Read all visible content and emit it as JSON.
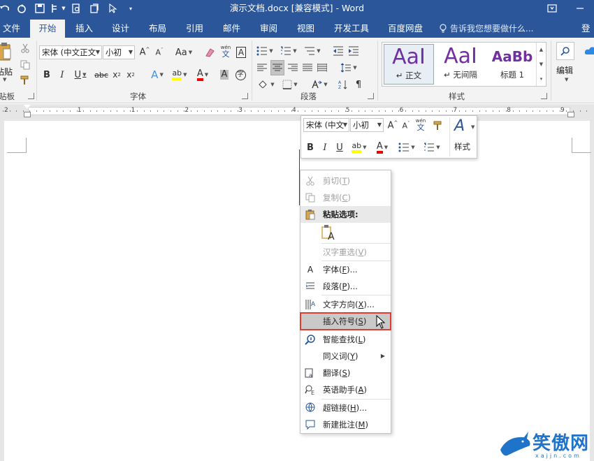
{
  "window": {
    "title": "演示文档.docx [兼容模式] - Word"
  },
  "ribbon_tabs": [
    {
      "label": "文件",
      "active": false
    },
    {
      "label": "开始",
      "active": true
    },
    {
      "label": "插入",
      "active": false
    },
    {
      "label": "设计",
      "active": false
    },
    {
      "label": "布局",
      "active": false
    },
    {
      "label": "引用",
      "active": false
    },
    {
      "label": "邮件",
      "active": false
    },
    {
      "label": "审阅",
      "active": false
    },
    {
      "label": "视图",
      "active": false
    },
    {
      "label": "开发工具",
      "active": false
    },
    {
      "label": "百度网盘",
      "active": false
    }
  ],
  "tell_me": "告诉我您想要做什么...",
  "login": "登录",
  "ribbon": {
    "clipboard": {
      "paste_label": "粘贴",
      "group_label": "贴板"
    },
    "font": {
      "font_name": "宋体 (中文正文",
      "font_size": "小初",
      "group_label": "字体",
      "change_case": "Aa",
      "phonetic": "wén"
    },
    "paragraph": {
      "group_label": "段落"
    },
    "styles": {
      "group_label": "样式",
      "items": [
        {
          "sample": "AaI",
          "name": "↵ 正文"
        },
        {
          "sample": "AaI",
          "name": "↵ 无间隔"
        },
        {
          "sample": "AaBb",
          "name": "标题 1"
        }
      ]
    },
    "editing": {
      "label": "编辑"
    }
  },
  "ruler": {
    "numbers": [
      "2",
      "1",
      "1",
      "2",
      "3",
      "4",
      "5",
      "6",
      "7",
      "8",
      "9",
      "10"
    ]
  },
  "mini_toolbar": {
    "font_name": "宋体 (中文",
    "font_size": "小初",
    "styles_label": "样式",
    "phonetic": "wén"
  },
  "context_menu": {
    "items": [
      {
        "label": "剪切(T)",
        "text": "剪切(",
        "key": "T",
        "close": ")",
        "icon": "scissors-icon",
        "disabled": true
      },
      {
        "label": "复制(C)",
        "text": "复制(",
        "key": "C",
        "close": ")",
        "icon": "copy-icon",
        "disabled": true
      },
      {
        "label": "粘贴选项:",
        "text": "粘贴选项:",
        "key": "",
        "close": "",
        "icon": "paste-icon",
        "header": true
      },
      {
        "label": "汉字重选(V)",
        "text": "汉字重选(",
        "key": "V",
        "close": ")",
        "icon": "",
        "disabled": true
      },
      {
        "label": "字体(F)...",
        "text": "字体(",
        "key": "F",
        "close": ")...",
        "icon": "font-icon"
      },
      {
        "label": "段落(P)...",
        "text": "段落(",
        "key": "P",
        "close": ")...",
        "icon": "paragraph-icon"
      },
      {
        "label": "文字方向(X)...",
        "text": "文字方向(",
        "key": "X",
        "close": ")...",
        "icon": "text-direction-icon"
      },
      {
        "label": "插入符号(S)",
        "text": "插入符号(",
        "key": "S",
        "close": ")",
        "icon": "",
        "highlight": true
      },
      {
        "label": "智能查找(L)",
        "text": "智能查找(",
        "key": "L",
        "close": ")",
        "icon": "smart-lookup-icon"
      },
      {
        "label": "同义词(Y)",
        "text": "同义词(",
        "key": "Y",
        "close": ")",
        "icon": "",
        "submenu": true
      },
      {
        "label": "翻译(S)",
        "text": "翻译(",
        "key": "S",
        "close": ")",
        "icon": "translate-icon"
      },
      {
        "label": "英语助手(A)",
        "text": "英语助手(",
        "key": "A",
        "close": ")",
        "icon": "english-assistant-icon"
      },
      {
        "label": "超链接(H)...",
        "text": "超链接(",
        "key": "H",
        "close": ")...",
        "icon": "hyperlink-icon"
      },
      {
        "label": "新建批注(M)",
        "text": "新建批注(",
        "key": "M",
        "close": ")",
        "icon": "comment-icon"
      }
    ]
  },
  "watermark": {
    "text": "笑傲网",
    "sub": "xajjn.com"
  },
  "colors": {
    "brand": "#2b579a",
    "highlight_outline": "#e03c31",
    "style_sample": "#7030a0"
  }
}
